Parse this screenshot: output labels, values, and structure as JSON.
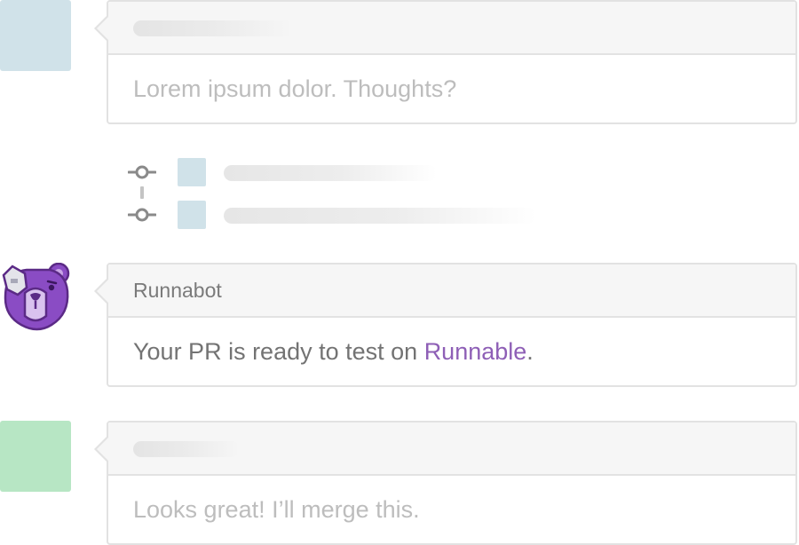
{
  "comments": [
    {
      "author_name": "",
      "avatar_color": "#d0e2e9",
      "text": "Lorem ipsum dolor. Thoughts?"
    },
    {
      "author_name": "Runnabot",
      "avatar_icon": "runnabot-bear-icon",
      "text_prefix": "Your PR is ready to test on ",
      "link_text": "Runnable",
      "text_suffix": ".",
      "link_color": "#8e5fb6"
    },
    {
      "author_name": "",
      "avatar_color": "#b7e6c4",
      "text": "Looks great! I’ll merge this."
    }
  ],
  "commits": [
    {
      "icon": "commit-icon",
      "avatar_color": "#d0e2e9",
      "message": ""
    },
    {
      "icon": "commit-icon",
      "avatar_color": "#d0e2e9",
      "message": ""
    }
  ],
  "colors": {
    "border": "#e2e2e2",
    "header_bg": "#f6f6f6",
    "muted_text": "#bdbdbd",
    "body_text": "#737373",
    "bot_purple": "#7a3bb5"
  }
}
